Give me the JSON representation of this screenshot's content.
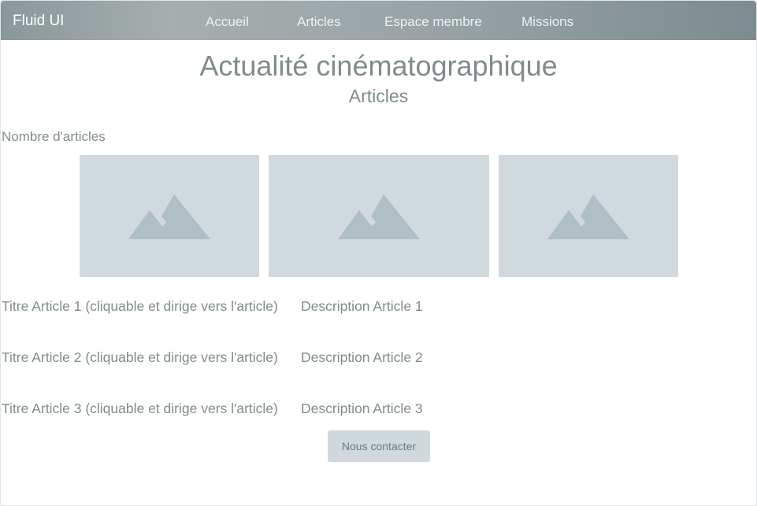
{
  "navbar": {
    "brand": "Fluid UI",
    "items": [
      {
        "label": "Accueil"
      },
      {
        "label": "Articles"
      },
      {
        "label": "Espace membre"
      },
      {
        "label": "Missions"
      }
    ]
  },
  "main": {
    "title": "Actualité cinématographique",
    "subtitle": "Articles",
    "count_label": "Nombre d'articles",
    "thumbnails": [
      {
        "icon": "image-placeholder-icon"
      },
      {
        "icon": "image-placeholder-icon"
      },
      {
        "icon": "image-placeholder-icon"
      }
    ],
    "articles": [
      {
        "title": "Titre Article 1 (cliquable et dirige vers l'article)",
        "description": "Description Article 1"
      },
      {
        "title": "Titre Article 2 (cliquable et dirige vers l'article)",
        "description": "Description Article 2"
      },
      {
        "title": "Titre Article 3 (cliquable et dirige vers l'article)",
        "description": "Description Article 3"
      }
    ],
    "contact_button": "Nous contacter"
  },
  "colors": {
    "text": "#7f8c8d",
    "placeholder_bg": "#d0d9de",
    "placeholder_icon": "#b0bec5",
    "button_bg": "#cfd8dc"
  }
}
